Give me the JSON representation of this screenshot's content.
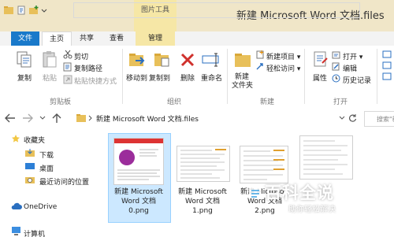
{
  "window": {
    "title": "新建 Microsoft Word 文档.files"
  },
  "context_tab": {
    "group_label": "图片工具",
    "tab_label": "管理"
  },
  "tabs": {
    "file": "文件",
    "home": "主页",
    "share": "共享",
    "view": "查看"
  },
  "ribbon": {
    "clipboard": {
      "copy": "复制",
      "paste": "粘贴",
      "cut": "剪切",
      "copy_path": "复制路径",
      "paste_shortcut": "粘贴快捷方式",
      "group": "剪贴板"
    },
    "organize": {
      "move_to": "移动到",
      "copy_to": "复制到",
      "delete": "删除",
      "rename": "重命名",
      "group": "组织"
    },
    "new": {
      "new_folder_line1": "新建",
      "new_folder_line2": "文件夹",
      "new_item": "新建项目",
      "easy_access": "轻松访问",
      "group": "新建"
    },
    "open": {
      "properties": "属性",
      "open": "打开",
      "edit": "编辑",
      "history": "历史记录",
      "group": "打开"
    }
  },
  "address": {
    "path": "新建 Microsoft Word 文档.files",
    "search_placeholder": "搜索\"新"
  },
  "nav": {
    "items": [
      {
        "label": "收藏夹",
        "icon": "star-icon"
      },
      {
        "label": "下载",
        "icon": "download-folder-icon"
      },
      {
        "label": "桌面",
        "icon": "desktop-icon"
      },
      {
        "label": "最近访问的位置",
        "icon": "recent-places-icon"
      },
      {
        "label": "OneDrive",
        "icon": "cloud-icon"
      },
      {
        "label": "计算机",
        "icon": "computer-icon"
      }
    ]
  },
  "files": [
    {
      "name_line1": "新建 Microsoft",
      "name_line2": "Word 文档",
      "name_line3": "0.png"
    },
    {
      "name_line1": "新建 Microsoft",
      "name_line2": "Word 文档",
      "name_line3": "1.png"
    },
    {
      "name_line1": "新建 Microsoft",
      "name_line2": "Word 文档",
      "name_line3": "2.png"
    },
    {
      "name_line1": "",
      "name_line2": "",
      "name_line3": ""
    }
  ],
  "watermark": {
    "title": "百科全说",
    "subtitle": "助你轻松解决"
  },
  "colors": {
    "file_tab": "#1979ca",
    "context": "#f6e7a6",
    "selection": "#cce8ff",
    "folder": "#e8c05a"
  }
}
